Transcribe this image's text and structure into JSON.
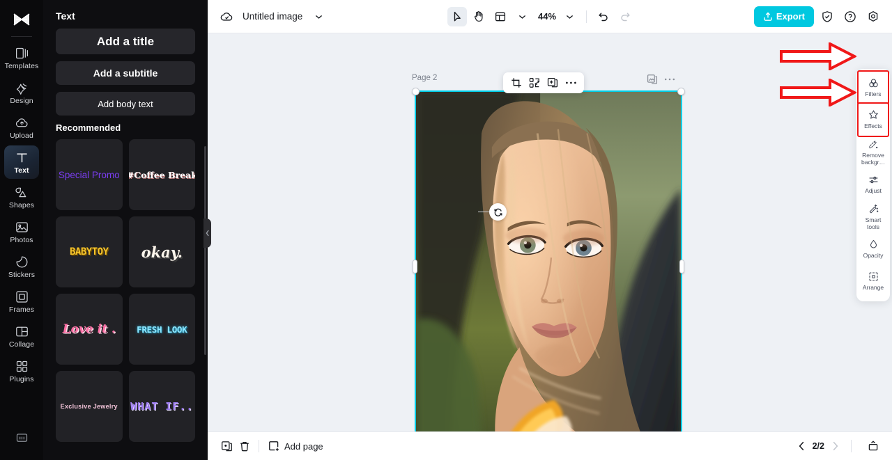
{
  "left_rail": {
    "logo_icon": "capcut-logo-icon",
    "items": [
      {
        "label": "Templates",
        "icon": "templates-icon",
        "active": false
      },
      {
        "label": "Design",
        "icon": "design-icon",
        "active": false
      },
      {
        "label": "Upload",
        "icon": "upload-cloud-icon",
        "active": false
      },
      {
        "label": "Text",
        "icon": "text-t-icon",
        "active": true
      },
      {
        "label": "Shapes",
        "icon": "shapes-icon",
        "active": false
      },
      {
        "label": "Photos",
        "icon": "photos-image-icon",
        "active": false
      },
      {
        "label": "Stickers",
        "icon": "stickers-icon",
        "active": false
      },
      {
        "label": "Frames",
        "icon": "frames-icon",
        "active": false
      },
      {
        "label": "Collage",
        "icon": "collage-icon",
        "active": false
      },
      {
        "label": "Plugins",
        "icon": "plugins-grid-icon",
        "active": false
      }
    ],
    "bottom_icon": "whiteboard-icon"
  },
  "text_panel": {
    "title": "Text",
    "add_title": "Add a title",
    "add_subtitle": "Add a subtitle",
    "add_body": "Add body text",
    "recommended_label": "Recommended",
    "presets": [
      {
        "text": "Special Promo",
        "style": "ct-purple"
      },
      {
        "text": "#Coffee Break",
        "style": "ct-coffee"
      },
      {
        "text": "BABYTOY",
        "style": "ct-baby"
      },
      {
        "text": "okay.",
        "style": "ct-okay"
      },
      {
        "text": "Love it .",
        "style": "ct-love"
      },
      {
        "text": "FRESH LOOK",
        "style": "ct-fresh"
      },
      {
        "text": "Exclusive Jewelry",
        "style": "ct-jewel"
      },
      {
        "text": "WHAT IF..",
        "style": "ct-what"
      }
    ]
  },
  "topbar": {
    "cloud_icon": "cloud-saved-icon",
    "doc_title": "Untitled image",
    "title_caret_icon": "chevron-down-icon",
    "select_tool_icon": "cursor-select-icon",
    "hand_tool_icon": "hand-pan-icon",
    "layout_tool_icon": "layout-panel-icon",
    "layout_caret_icon": "chevron-down-icon",
    "zoom_value": "44%",
    "zoom_caret_icon": "chevron-down-icon",
    "undo_icon": "undo-arrow-icon",
    "redo_icon": "redo-arrow-icon",
    "export_label": "Export",
    "export_icon": "export-upload-icon",
    "export_color": "#00c8e0",
    "shield_icon": "shield-check-icon",
    "help_icon": "help-question-icon",
    "settings_icon": "gear-settings-icon"
  },
  "canvas": {
    "page_label": "Page 2",
    "selection_color": "#00cfe8",
    "float_tools": [
      {
        "icon": "crop-icon"
      },
      {
        "icon": "replace-swap-icon"
      },
      {
        "icon": "duplicate-add-icon"
      },
      {
        "icon": "more-dots-icon"
      }
    ],
    "corner_tools": [
      {
        "icon": "copy-layers-icon"
      },
      {
        "icon": "more-dots-icon"
      }
    ],
    "rotate_icon": "rotate-handle-icon"
  },
  "right_panel": {
    "highlight_color": "#f01818",
    "items": [
      {
        "label": "Filters",
        "icon": "filters-circles-icon",
        "highlighted": true
      },
      {
        "label": "Effects",
        "icon": "effects-sparkle-icon",
        "highlighted": true
      },
      {
        "label": "Remove\nbackgr…",
        "icon": "remove-background-icon",
        "highlighted": false
      },
      {
        "label": "Adjust",
        "icon": "adjust-sliders-icon",
        "highlighted": false
      },
      {
        "label": "Smart\ntools",
        "icon": "smart-tools-wand-icon",
        "highlighted": false
      },
      {
        "label": "Opacity",
        "icon": "opacity-droplet-icon",
        "highlighted": false
      },
      {
        "label": "Arrange",
        "icon": "arrange-layers-icon",
        "highlighted": false
      }
    ]
  },
  "bottombar": {
    "duplicate_icon": "duplicate-page-icon",
    "delete_icon": "trash-delete-icon",
    "add_page_label": "Add page",
    "add_page_icon": "add-page-icon",
    "prev_icon": "chevron-left-icon",
    "page_indicator": "2/2",
    "next_icon": "chevron-right-icon",
    "present_icon": "present-icon"
  },
  "annotations": {
    "arrow1": "red-arrow-pointing-to-filters",
    "arrow2": "red-arrow-pointing-to-effects",
    "arrow_color": "#f01818"
  }
}
